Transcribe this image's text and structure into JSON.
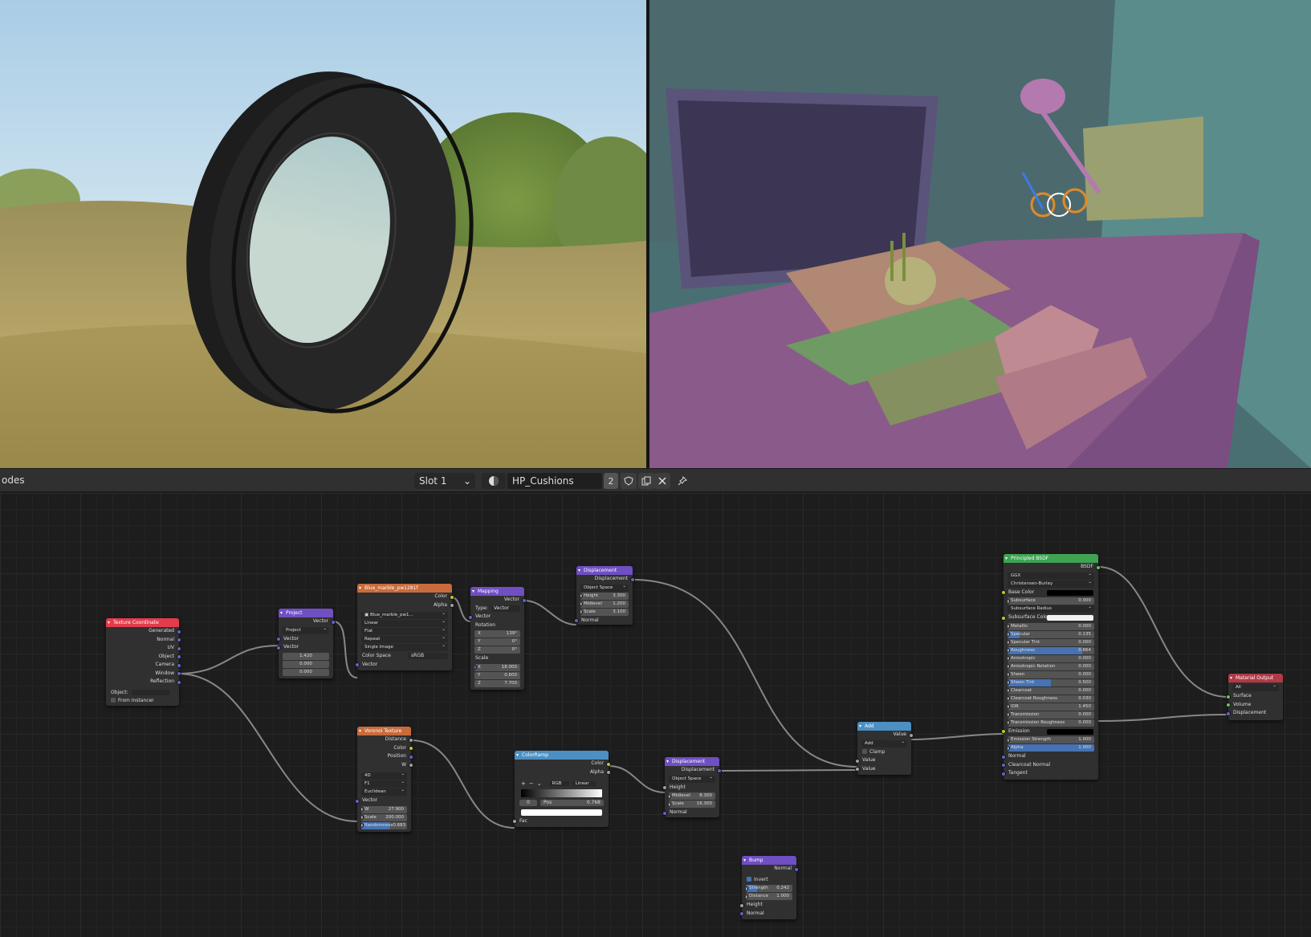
{
  "header": {
    "editor_label": "odes",
    "slot": "Slot 1",
    "material_name": "HP_Cushions",
    "user_count": "2"
  },
  "colors": {
    "accent_blue": "#4772b3",
    "header_input": "#e13c4d",
    "header_texture": "#c96b3b",
    "header_vector": "#6f4fc2",
    "header_converter": "#4c8fc2",
    "header_shader": "#3ea352",
    "header_output": "#b03a45",
    "socket_color": "#c7c729",
    "socket_float": "#a1a1a1",
    "socket_vector": "#6363c7",
    "socket_shader": "#63c763"
  },
  "nodes": {
    "texcoord": {
      "title": "Texture Coordinate",
      "outputs": [
        "Generated",
        "Normal",
        "UV",
        "Object",
        "Camera",
        "Window",
        "Reflection"
      ],
      "object_label": "Object:",
      "from_instancer": "From Instancer"
    },
    "project": {
      "title": "Project",
      "output": "Vector",
      "mode": "Project",
      "input1": "Vector",
      "input2": "Vector",
      "values": [
        "1.420",
        "0.000",
        "0.000"
      ]
    },
    "image": {
      "title": "Blue_marble_pw1281f",
      "outputs": [
        "Color",
        "Alpha"
      ],
      "image_name": "Blue_marble_pw1...",
      "interpolation": "Linear",
      "projection": "Flat",
      "extension": "Repeat",
      "source": "Single Image",
      "colorspace_label": "Color Space",
      "colorspace": "sRGB",
      "input": "Vector"
    },
    "mapping": {
      "title": "Mapping",
      "output": "Vector",
      "type_label": "Type:",
      "type": "Vector",
      "input": "Vector",
      "rotation_label": "Rotation",
      "rotation": {
        "x": "139°",
        "y": "0°",
        "z": "0°"
      },
      "scale_label": "Scale",
      "scale": {
        "x": "18.000",
        "y": "0.600",
        "z": "7.700"
      },
      "axis": {
        "x": "X",
        "y": "Y",
        "z": "Z"
      }
    },
    "disp1": {
      "title": "Displacement",
      "output": "Displacement",
      "space": "Object Space",
      "height_label": "Height",
      "height": "3.300",
      "midlevel_label": "Midlevel",
      "midlevel": "1.200",
      "scale_label": "Scale",
      "scale": "3.100",
      "normal": "Normal"
    },
    "voronoi": {
      "title": "Voronoi Texture",
      "outputs": [
        "Distance",
        "Color",
        "Position",
        "W"
      ],
      "dimensions": "4D",
      "feature": "F1",
      "metric": "Euclidean",
      "input": "Vector",
      "w_label": "W",
      "w": "27.900",
      "scale_label": "Scale",
      "scale": "200.000",
      "randomness_label": "Randomness",
      "randomness": "0.683"
    },
    "colorramp": {
      "title": "ColorRamp",
      "outputs": [
        "Color",
        "Alpha"
      ],
      "plus": "+",
      "minus": "−",
      "mode": "RGB",
      "interp": "Linear",
      "index": "0",
      "pos_label": "Pos",
      "pos": "0.768",
      "input": "Fac"
    },
    "disp2": {
      "title": "Displacement",
      "output": "Displacement",
      "space": "Object Space",
      "height": "Height",
      "midlevel_label": "Midlevel",
      "midlevel": "8.300",
      "scale_label": "Scale",
      "scale": "16.300",
      "normal": "Normal"
    },
    "add": {
      "title": "Add",
      "output": "Value",
      "op": "Add",
      "clamp": "Clamp",
      "inputs": [
        "Value",
        "Value"
      ]
    },
    "bump": {
      "title": "Bump",
      "output": "Normal",
      "invert": "Invert",
      "strength_label": "Strength",
      "strength": "0.242",
      "distance_label": "Distance",
      "distance": "1.000",
      "inputs": [
        "Height",
        "Normal"
      ]
    },
    "bsdf": {
      "title": "Principled BSDF",
      "output": "BSDF",
      "distribution": "GGX",
      "subsurface_method": "Christensen-Burley",
      "base_color": "Base Color",
      "subsurface": {
        "label": "Subsurface",
        "value": "0.000"
      },
      "subsurface_radius": "Subsurface Radius",
      "subsurface_color": "Subsurface Colo",
      "fields": [
        {
          "label": "Metallic",
          "value": "0.000"
        },
        {
          "label": "Specular",
          "value": "0.135"
        },
        {
          "label": "Specular Tint",
          "value": "0.000"
        },
        {
          "label": "Roughness",
          "value": "0.864"
        },
        {
          "label": "Anisotropic",
          "value": "0.000"
        },
        {
          "label": "Anisotropic Rotation",
          "value": "0.000"
        },
        {
          "label": "Sheen",
          "value": "0.000"
        },
        {
          "label": "Sheen Tint",
          "value": "0.500"
        },
        {
          "label": "Clearcoat",
          "value": "0.000"
        },
        {
          "label": "Clearcoat Roughness",
          "value": "0.030"
        },
        {
          "label": "IOR",
          "value": "1.450"
        },
        {
          "label": "Transmission",
          "value": "0.000"
        },
        {
          "label": "Transmission Roughness",
          "value": "0.000"
        }
      ],
      "emission": "Emission",
      "emission_strength": {
        "label": "Emission Strength",
        "value": "1.000"
      },
      "alpha": {
        "label": "Alpha",
        "value": "1.000"
      },
      "normal": "Normal",
      "clearcoat_normal": "Clearcoat Normal",
      "tangent": "Tangent"
    },
    "output": {
      "title": "Material Output",
      "target": "All",
      "inputs": [
        "Surface",
        "Volume",
        "Displacement"
      ]
    }
  }
}
